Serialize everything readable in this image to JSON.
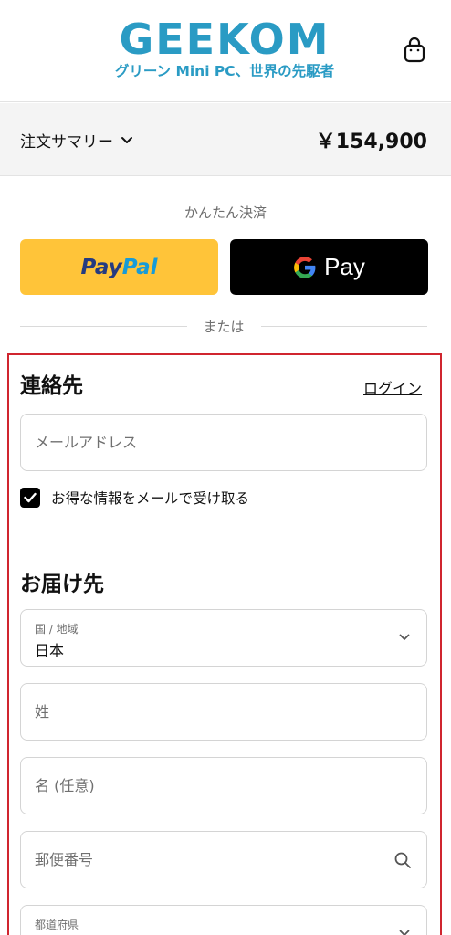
{
  "header": {
    "logo_text": "GEEKOM",
    "tagline": "グリーン Mini PC、世界の先駆者",
    "cart_icon": "shopping-bag-icon"
  },
  "summary": {
    "label": "注文サマリー",
    "total": "￥154,900"
  },
  "express": {
    "label": "かんたん決済",
    "paypal_part1": "Pay",
    "paypal_part2": "Pal",
    "gpay_label": "Pay",
    "or_label": "または"
  },
  "contact": {
    "title": "連絡先",
    "login": "ログイン",
    "email_placeholder": "メールアドレス",
    "newsletter_label": "お得な情報をメールで受け取る",
    "newsletter_checked": true
  },
  "shipping": {
    "title": "お届け先",
    "country_label": "国 / 地域",
    "country_value": "日本",
    "last_name_placeholder": "姓",
    "first_name_placeholder": "名 (任意)",
    "postal_placeholder": "郵便番号",
    "prefecture_label": "都道府県"
  },
  "colors": {
    "brand": "#2a9bc4",
    "paypal_yellow": "#ffc439",
    "highlight_frame": "#d0252f"
  }
}
